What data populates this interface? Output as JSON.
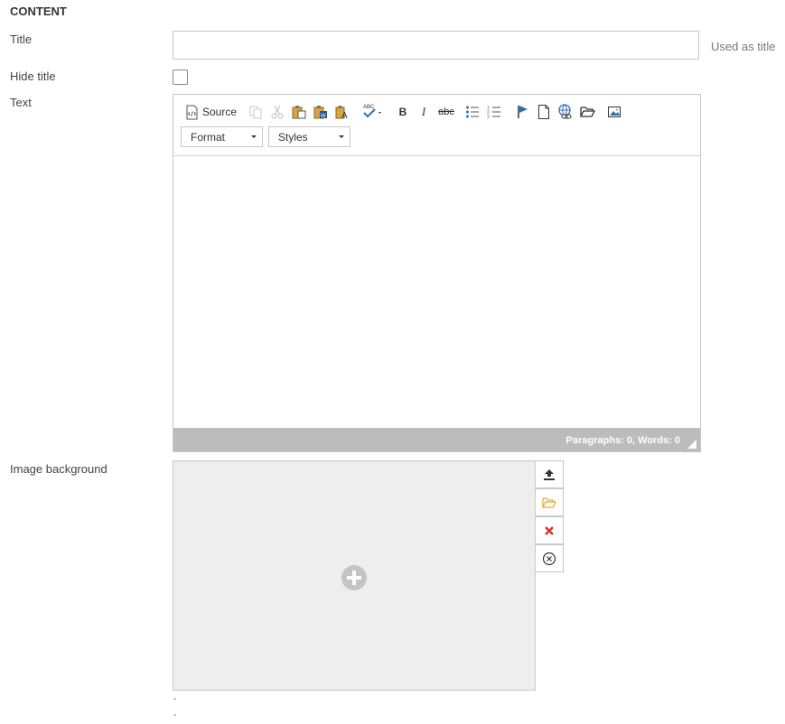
{
  "section": {
    "title": "CONTENT"
  },
  "fields": {
    "title_label": "Title",
    "title_value": "",
    "title_hint": "Used as title",
    "hide_title_label": "Hide title",
    "text_label": "Text",
    "image_label": "Image background"
  },
  "editor": {
    "source_label": "Source",
    "format_label": "Format",
    "styles_label": "Styles",
    "bold": "B",
    "italic": "I",
    "strike": "abc",
    "spell": "ABC",
    "status": "Paragraphs: 0, Words: 0"
  },
  "image": {
    "lines": [
      "-",
      "-"
    ]
  },
  "colors": {
    "folder": "#e8a72a",
    "delete": "#d9342b",
    "statusbar": "#bcbcbc"
  }
}
